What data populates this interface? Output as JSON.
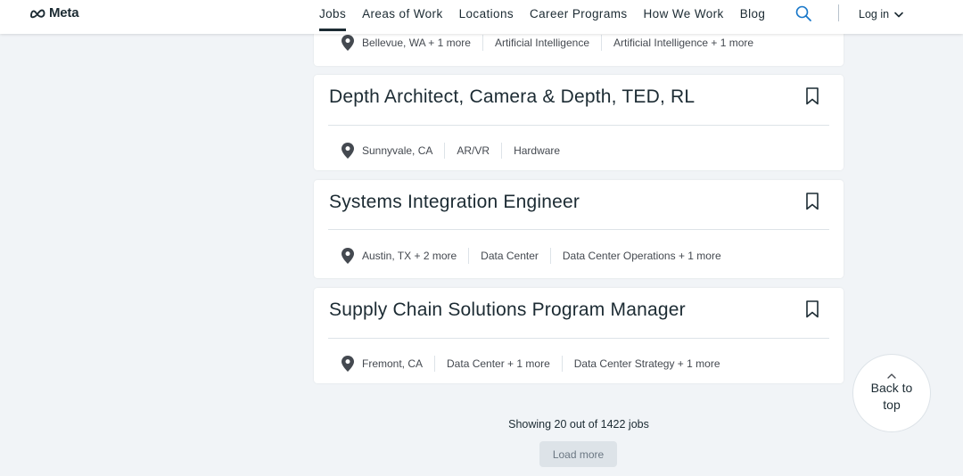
{
  "header": {
    "logo_text": "Meta",
    "nav": [
      "Jobs",
      "Areas of Work",
      "Locations",
      "Career Programs",
      "How We Work",
      "Blog"
    ],
    "active_nav": "Jobs",
    "login_label": "Log in"
  },
  "jobs": [
    {
      "title": "",
      "location": "Bellevue, WA + 1 more",
      "tags": [
        "Artificial Intelligence",
        "Artificial Intelligence + 1 more"
      ]
    },
    {
      "title": "Depth Architect, Camera & Depth, TED, RL",
      "location": "Sunnyvale, CA",
      "tags": [
        "AR/VR",
        "Hardware"
      ]
    },
    {
      "title": "Systems Integration Engineer",
      "location": "Austin, TX + 2 more",
      "tags": [
        "Data Center",
        "Data Center Operations + 1 more"
      ]
    },
    {
      "title": "Supply Chain Solutions Program Manager",
      "location": "Fremont, CA",
      "tags": [
        "Data Center + 1 more",
        "Data Center Strategy + 1 more"
      ]
    }
  ],
  "footer": {
    "showing_text": "Showing 20 out of 1422 jobs",
    "load_more_label": "Load more",
    "back_to_top_label": "Back to top"
  },
  "colors": {
    "background": "#f1f4f7",
    "text": "#1c2b33",
    "card": "#ffffff",
    "pin": "#444950"
  }
}
